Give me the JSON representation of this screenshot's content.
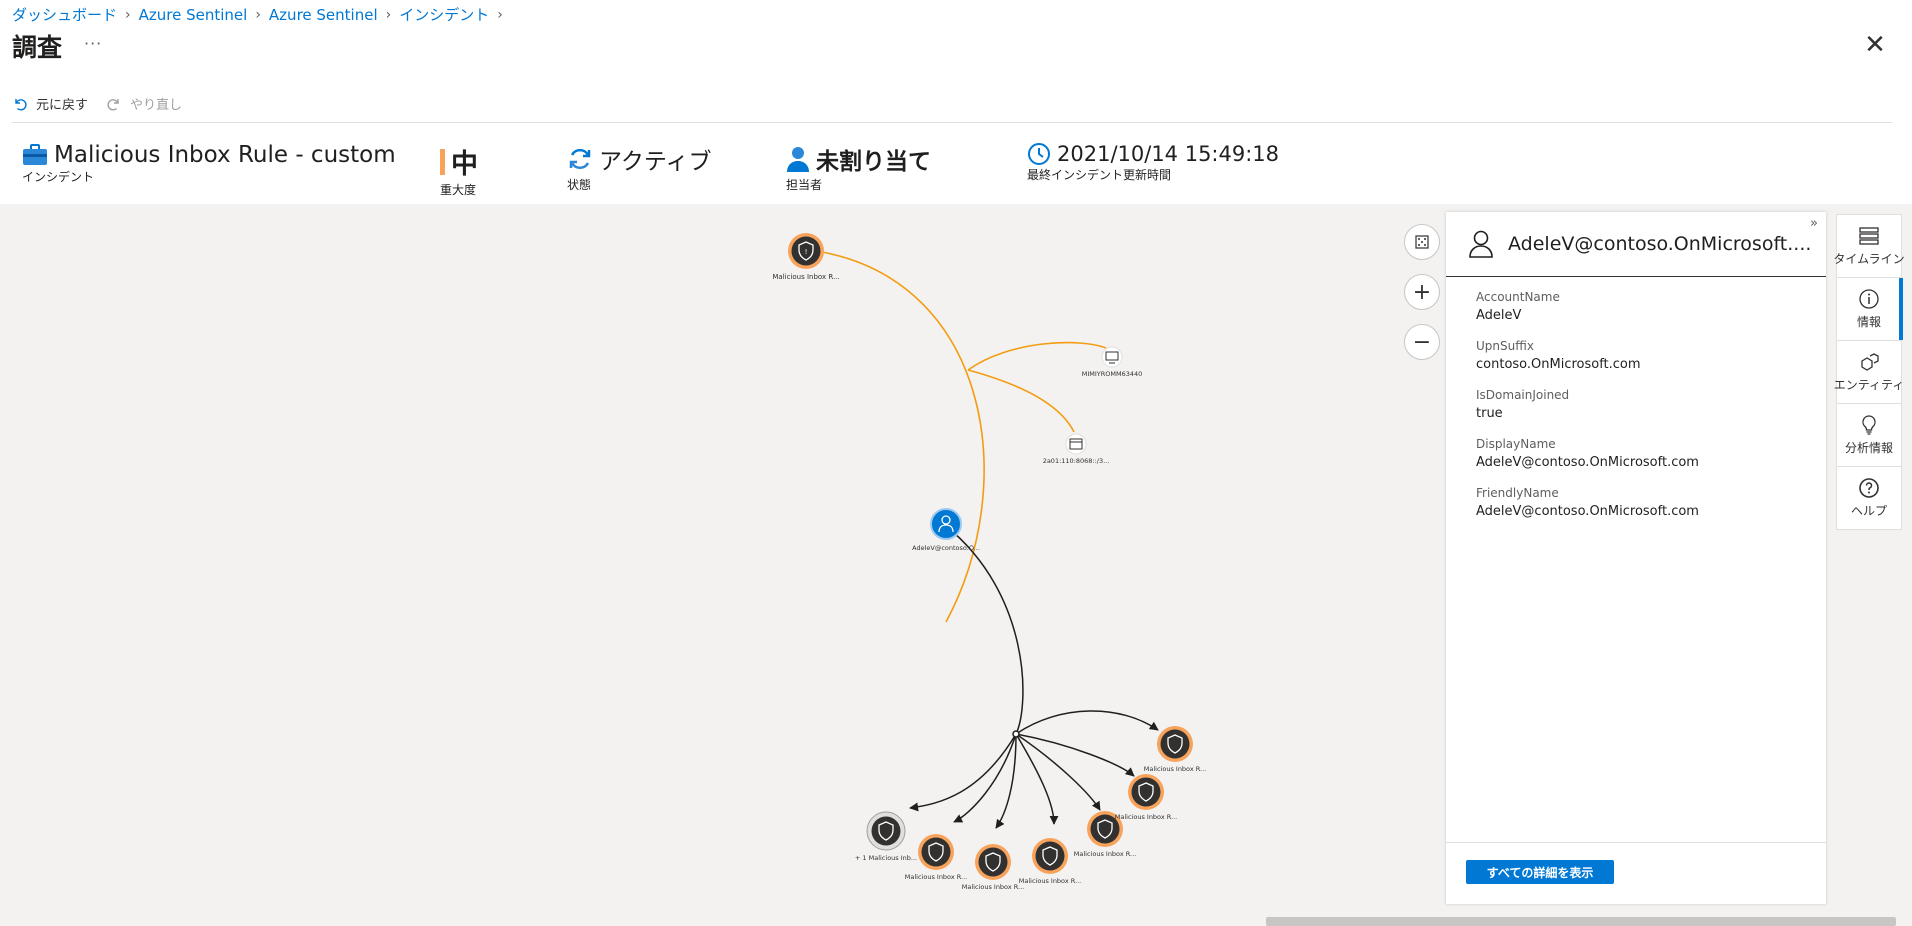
{
  "breadcrumb": [
    "ダッシュボード",
    "Azure Sentinel",
    "Azure Sentinel",
    "インシデント"
  ],
  "page_title": "調査",
  "more_label": "···",
  "close_label": "✕",
  "toolbar": {
    "undo_label": "元に戻す",
    "redo_label": "やり直し"
  },
  "incident": {
    "name": "Malicious Inbox Rule - custom",
    "name_caption": "インシデント",
    "severity": "中",
    "severity_caption": "重大度",
    "status": "アクティブ",
    "status_caption": "状態",
    "owner": "未割り当て",
    "owner_caption": "担当者",
    "updated": "2021/10/14 15:49:18",
    "updated_caption": "最終インシデント更新時間"
  },
  "graph": {
    "nodes": [
      {
        "id": "alert-top",
        "label": "Malicious Inbox R..."
      },
      {
        "id": "host",
        "label": "MIMIYROMM63440"
      },
      {
        "id": "url",
        "label": "2a01:110:8068::/3..."
      },
      {
        "id": "account",
        "label": "AdeleV@contoso.O..."
      },
      {
        "id": "group",
        "label": "+ 1 Malicious Inb..."
      },
      {
        "id": "alert-1",
        "label": "Malicious Inbox R..."
      },
      {
        "id": "alert-2",
        "label": "Malicious Inbox R..."
      },
      {
        "id": "alert-3",
        "label": "Malicious Inbox R..."
      },
      {
        "id": "alert-4",
        "label": "Malicious Inbox R..."
      },
      {
        "id": "alert-5",
        "label": "Malicious Inbox R..."
      },
      {
        "id": "alert-6",
        "label": "Malicious Inbox R..."
      }
    ]
  },
  "panel": {
    "title": "AdeleV@contoso.OnMicrosoft....",
    "properties": [
      {
        "key": "AccountName",
        "value": "AdeleV"
      },
      {
        "key": "UpnSuffix",
        "value": "contoso.OnMicrosoft.com"
      },
      {
        "key": "IsDomainJoined",
        "value": "true"
      },
      {
        "key": "DisplayName",
        "value": "AdeleV@contoso.OnMicrosoft.com"
      },
      {
        "key": "FriendlyName",
        "value": "AdeleV@contoso.OnMicrosoft.com"
      }
    ],
    "show_all_label": "すべての詳細を表示"
  },
  "rail": [
    {
      "label": "タイムライン",
      "icon": "timeline-icon"
    },
    {
      "label": "情報",
      "icon": "info-icon",
      "active": true
    },
    {
      "label": "エンティティ",
      "icon": "entities-icon"
    },
    {
      "label": "分析情報",
      "icon": "insights-icon"
    },
    {
      "label": "ヘルプ",
      "icon": "help-icon"
    }
  ],
  "colors": {
    "accent": "#0078d4",
    "alert_ring": "#f7a35c",
    "edge_primary": "#f39c12",
    "severity_medium": "#f7a35c"
  }
}
